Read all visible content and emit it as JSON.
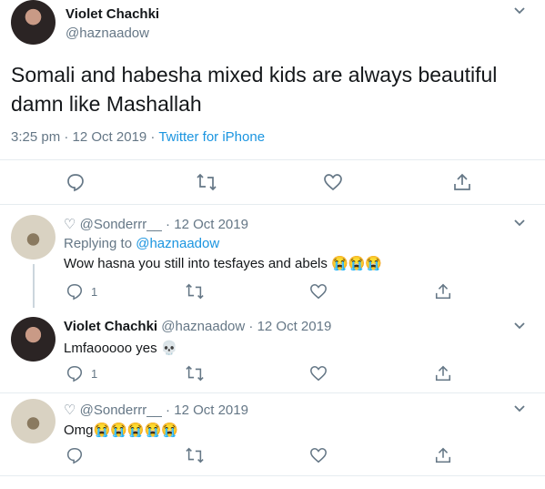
{
  "main_tweet": {
    "author_name": "Violet Chachki",
    "author_handle": "@haznaadow",
    "text": "Somali and habesha mixed kids are always beautiful damn like Mashallah",
    "timestamp": "3:25 pm · 12 Oct 2019",
    "separator": " · ",
    "source": "Twitter for iPhone"
  },
  "replies": [
    {
      "author_prefix": "♡ @Sonderrr__",
      "date": " · 12 Oct 2019",
      "replying_label": "Replying to ",
      "replying_handle": "@haznaadow",
      "text": "Wow hasna you still into tesfayes and abels 😭😭😭",
      "reply_count": "1"
    },
    {
      "author_name": "Violet Chachki",
      "author_handle": "@haznaadow",
      "date": " · 12 Oct 2019",
      "text": "Lmfaooooo yes 💀",
      "reply_count": "1"
    },
    {
      "author_prefix": "♡ @Sonderrr__",
      "date": " · 12 Oct 2019",
      "text": "Omg😭😭😭😭😭",
      "reply_count": ""
    }
  ],
  "icons": [
    "reply-icon",
    "retweet-icon",
    "like-icon",
    "share-icon",
    "chevron-down-icon"
  ],
  "colors": {
    "link": "#1b95e0",
    "muted": "#657786",
    "text": "#14171a",
    "divider": "#e6ecf0"
  }
}
